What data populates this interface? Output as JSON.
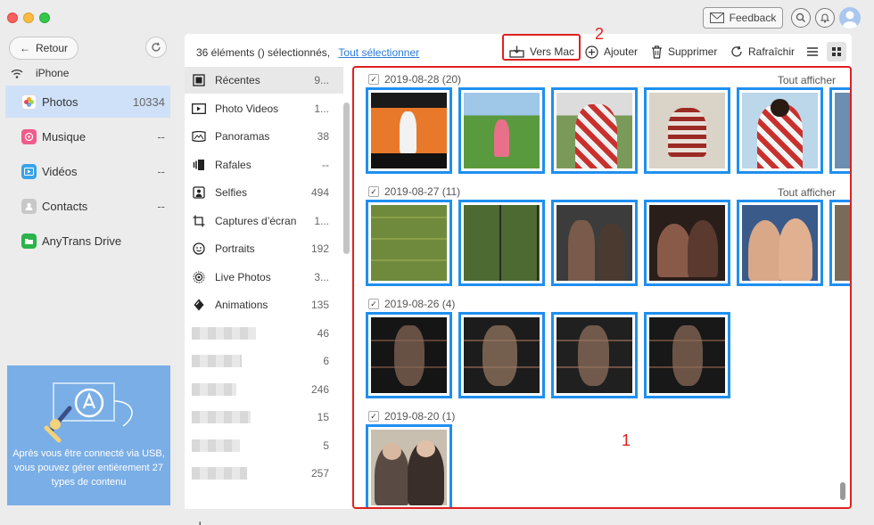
{
  "titlebar": {
    "feedback_label": "Feedback"
  },
  "sidebar": {
    "back_label": "Retour",
    "device_name": "iPhone",
    "items": [
      {
        "label": "Photos",
        "count": "10334",
        "icon": "photos-icon",
        "color": "#ffffff"
      },
      {
        "label": "Musique",
        "count": "--",
        "icon": "music-icon",
        "color": "#f05b8c"
      },
      {
        "label": "Vidéos",
        "count": "--",
        "icon": "video-icon",
        "color": "#3aa3e8"
      },
      {
        "label": "Contacts",
        "count": "--",
        "icon": "contacts-icon",
        "color": "#b3b3b3"
      },
      {
        "label": "AnyTrans Drive",
        "count": "",
        "icon": "drive-icon",
        "color": "#29b34a"
      }
    ],
    "promo_text": "Après vous être connecté via USB, vous pouvez gérer entièrement 27 types de contenu"
  },
  "toolbar": {
    "status": "36 éléments () sélectionnés,",
    "select_all": "Tout sélectionner",
    "to_mac": "Vers Mac",
    "add": "Ajouter",
    "delete": "Supprimer",
    "refresh": "Rafraîchir",
    "annotation_2": "2",
    "annotation_1": "1"
  },
  "categories": [
    {
      "label": "Récentes",
      "count": "9...",
      "icon": "recent-icon"
    },
    {
      "label": "Photo Videos",
      "count": "1...",
      "icon": "video-icon"
    },
    {
      "label": "Panoramas",
      "count": "38",
      "icon": "panorama-icon"
    },
    {
      "label": "Rafales",
      "count": "--",
      "icon": "burst-icon"
    },
    {
      "label": "Selfies",
      "count": "494",
      "icon": "selfie-icon"
    },
    {
      "label": "Captures d’écran",
      "count": "1...",
      "icon": "screenshot-icon"
    },
    {
      "label": "Portraits",
      "count": "192",
      "icon": "portrait-icon"
    },
    {
      "label": "Live Photos",
      "count": "3...",
      "icon": "live-photo-icon"
    },
    {
      "label": "Animations",
      "count": "135",
      "icon": "animation-icon"
    },
    {
      "label": "",
      "count": "46",
      "icon": ""
    },
    {
      "label": "",
      "count": "6",
      "icon": ""
    },
    {
      "label": "",
      "count": "246",
      "icon": ""
    },
    {
      "label": "",
      "count": "15",
      "icon": ""
    },
    {
      "label": "",
      "count": "5",
      "icon": ""
    },
    {
      "label": "",
      "count": "257",
      "icon": ""
    }
  ],
  "photo_groups": [
    {
      "date": "2019-08-28 (20)",
      "show_all": "Tout afficher",
      "thumbs": [
        "#e8792a",
        "#4a8f3a",
        "#b9352b",
        "#9c2a24",
        "#8bb6d8",
        "#6a8fb0"
      ]
    },
    {
      "date": "2019-08-27 (11)",
      "show_all": "Tout afficher",
      "thumbs": [
        "#6f8a3c",
        "#5e7a3a",
        "#4b4b4b",
        "#3a2a25",
        "#3a5a8a",
        "#7a6a5a"
      ]
    },
    {
      "date": "2019-08-26 (4)",
      "show_all": "",
      "thumbs": [
        "#2a2a2a",
        "#3a3a3a",
        "#4a4a4a",
        "#2f2f2f"
      ]
    },
    {
      "date": "2019-08-20 (1)",
      "show_all": "",
      "thumbs": [
        "#6a5a50"
      ]
    }
  ]
}
